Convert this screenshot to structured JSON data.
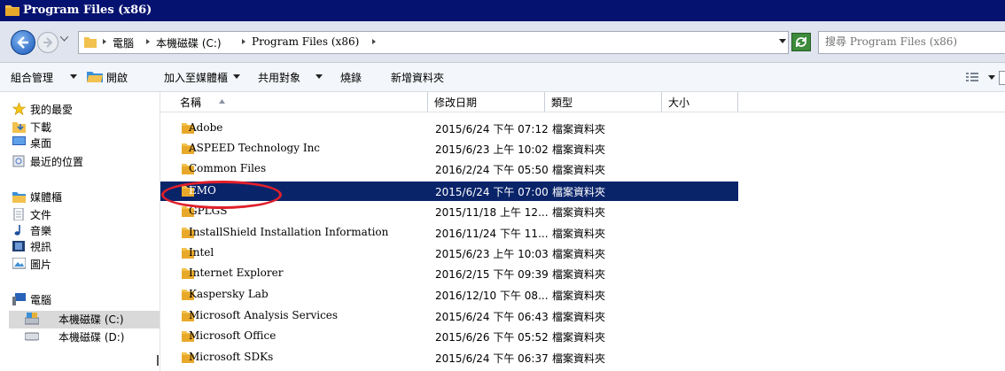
{
  "window": {
    "title": "Program Files (x86)"
  },
  "address": {
    "crumbs": [
      "電腦",
      "本機磁碟 (C:)",
      "Program Files (x86)"
    ]
  },
  "search": {
    "placeholder": "搜尋 Program Files (x86)"
  },
  "toolbar": {
    "organize": "組合管理",
    "open": "開啟",
    "add_to_library": "加入至媒體櫃",
    "share_with": "共用對象",
    "burn": "燒錄",
    "new_folder": "新增資料夾"
  },
  "nav": {
    "favorites": "我的最愛",
    "downloads": "下載",
    "desktop": "桌面",
    "recent": "最近的位置",
    "libraries": "媒體櫃",
    "documents": "文件",
    "music": "音樂",
    "videos": "視訊",
    "pictures": "圖片",
    "computer": "電腦",
    "drive_c": "本機磁碟 (C:)",
    "drive_d": "本機磁碟 (D:)"
  },
  "columns": {
    "name": "名稱",
    "date": "修改日期",
    "type": "類型",
    "size": "大小"
  },
  "files": [
    {
      "name": "Adobe",
      "date": "2015/6/24 下午 07:12",
      "type": "檔案資料夾"
    },
    {
      "name": "ASPEED Technology Inc",
      "date": "2015/6/23 上午 10:02",
      "type": "檔案資料夾"
    },
    {
      "name": "Common Files",
      "date": "2016/2/24 下午 05:50",
      "type": "檔案資料夾"
    },
    {
      "name": "EMO",
      "date": "2015/6/24 下午 07:00",
      "type": "檔案資料夾"
    },
    {
      "name": "GPLGS",
      "date": "2015/11/18 上午 12...",
      "type": "檔案資料夾"
    },
    {
      "name": "InstallShield Installation Information",
      "date": "2016/11/24 下午 11...",
      "type": "檔案資料夾"
    },
    {
      "name": "Intel",
      "date": "2015/6/23 上午 10:03",
      "type": "檔案資料夾"
    },
    {
      "name": "Internet Explorer",
      "date": "2016/2/15 下午 09:39",
      "type": "檔案資料夾"
    },
    {
      "name": "Kaspersky Lab",
      "date": "2016/12/10 下午 08...",
      "type": "檔案資料夾"
    },
    {
      "name": "Microsoft Analysis Services",
      "date": "2015/6/24 下午 06:43",
      "type": "檔案資料夾"
    },
    {
      "name": "Microsoft Office",
      "date": "2015/6/26 下午 05:52",
      "type": "檔案資料夾"
    },
    {
      "name": "Microsoft SDKs",
      "date": "2015/6/24 下午 06:37",
      "type": "檔案資料夾"
    }
  ],
  "colors": {
    "title_bar": "#06126f",
    "selection": "#0a246a",
    "highlight_ellipse": "#e0202b",
    "folder": "#e8b23a"
  }
}
